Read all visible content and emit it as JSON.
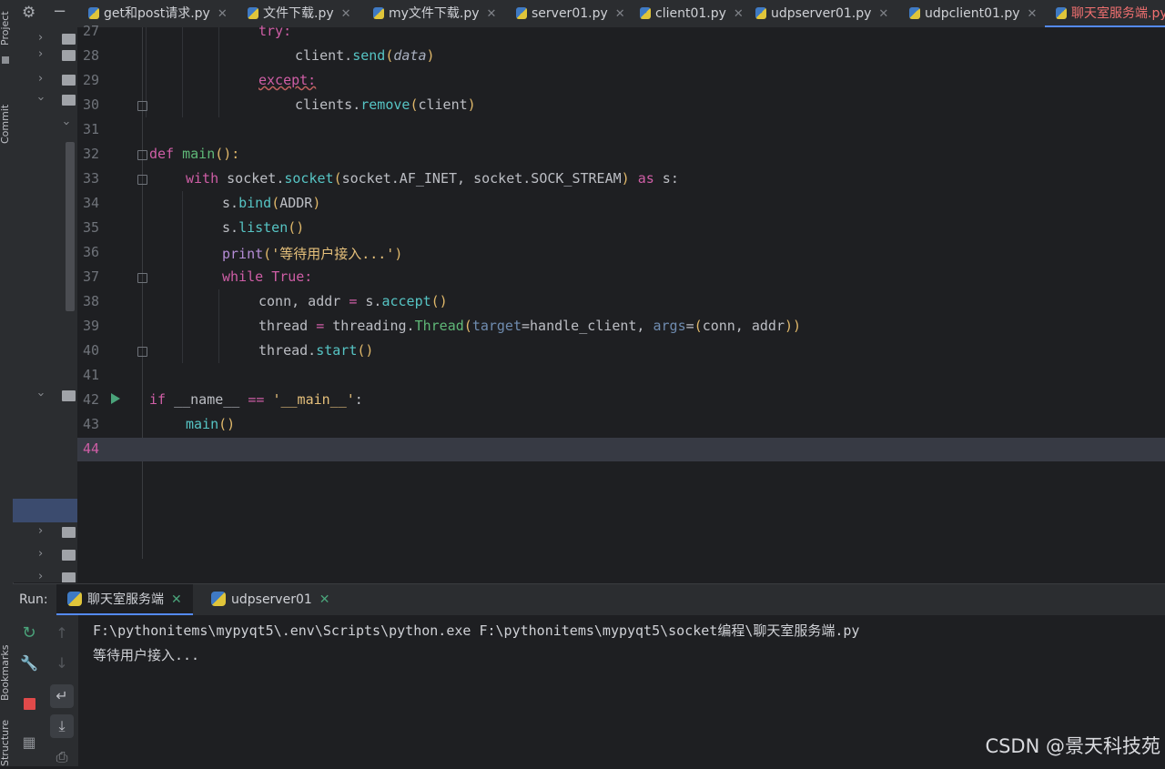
{
  "side_labels": {
    "project": "Project",
    "commit": "Commit",
    "bookmarks": "Bookmarks",
    "structure": "Structure"
  },
  "tabs": [
    {
      "label": "get和post请求.py",
      "active": false
    },
    {
      "label": "文件下载.py",
      "active": false
    },
    {
      "label": "my文件下载.py",
      "active": false
    },
    {
      "label": "server01.py",
      "active": false
    },
    {
      "label": "client01.py",
      "active": false
    },
    {
      "label": "udpserver01.py",
      "active": false
    },
    {
      "label": "udpclient01.py",
      "active": false
    },
    {
      "label": "聊天室服务端.py",
      "active": true
    }
  ],
  "icons": {
    "settings": "gear-icon",
    "minimize": "minus-icon",
    "close": "close-icon",
    "run": "run-triangle-icon"
  },
  "line_numbers": [
    "27",
    "28",
    "29",
    "30",
    "31",
    "32",
    "33",
    "34",
    "35",
    "36",
    "37",
    "38",
    "39",
    "40",
    "41",
    "42",
    "43",
    "44"
  ],
  "code": {
    "l27": "try:",
    "l28a": "client.",
    "l28b": "send",
    "l28c": "(",
    "l28d": "data",
    "l28e": ")",
    "l29": "except:",
    "l30a": "clients.",
    "l30b": "remove",
    "l30c": "(",
    "l30d": "client",
    "l30e": ")",
    "l32a": "def ",
    "l32b": "main",
    "l32c": "():",
    "l33a": "with ",
    "l33b": "socket.",
    "l33c": "socket",
    "l33d": "(",
    "l33e": "socket.AF_INET, socket.SOCK_STREAM",
    "l33f": ")",
    "l33g": " as ",
    "l33h": "s:",
    "l34a": "s.",
    "l34b": "bind",
    "l34c": "(",
    "l34d": "ADDR",
    "l34e": ")",
    "l35a": "s.",
    "l35b": "listen",
    "l35c": "()",
    "l36a": "print",
    "l36b": "(",
    "l36c": "'等待用户接入...'",
    "l36d": ")",
    "l37a": "while ",
    "l37b": "True:",
    "l38a": "conn, addr ",
    "l38b": "=",
    "l38c": " s.",
    "l38d": "accept",
    "l38e": "()",
    "l39a": "thread ",
    "l39b": "=",
    "l39c": " threading.",
    "l39d": "Thread",
    "l39e": "(",
    "l39f": "target",
    "l39g": "=handle_client, ",
    "l39h": "args",
    "l39i": "=",
    "l39j": "(",
    "l39k": "conn, addr",
    "l39l": ")",
    "l39m": ")",
    "l40a": "thread.",
    "l40b": "start",
    "l40c": "()",
    "l42a": "if ",
    "l42b": "__name__ ",
    "l42c": "== ",
    "l42d": "'__main__'",
    "l42e": ":",
    "l43a": "main",
    "l43b": "()"
  },
  "run": {
    "label": "Run:",
    "tabs": [
      {
        "label": "聊天室服务端",
        "active": true
      },
      {
        "label": "udpserver01",
        "active": false
      }
    ],
    "console": [
      "F:\\pythonitems\\mypyqt5\\.env\\Scripts\\python.exe F:\\pythonitems\\mypyqt5\\socket编程\\聊天室服务端.py",
      "等待用户接入..."
    ]
  },
  "watermark": "CSDN @景天科技苑",
  "colors": {
    "accent": "#548af7",
    "keyword": "#cf5ea6",
    "function": "#56c4c4",
    "string": "#e6c07b",
    "stop": "#e04a4a",
    "rerun": "#4aa37a"
  }
}
